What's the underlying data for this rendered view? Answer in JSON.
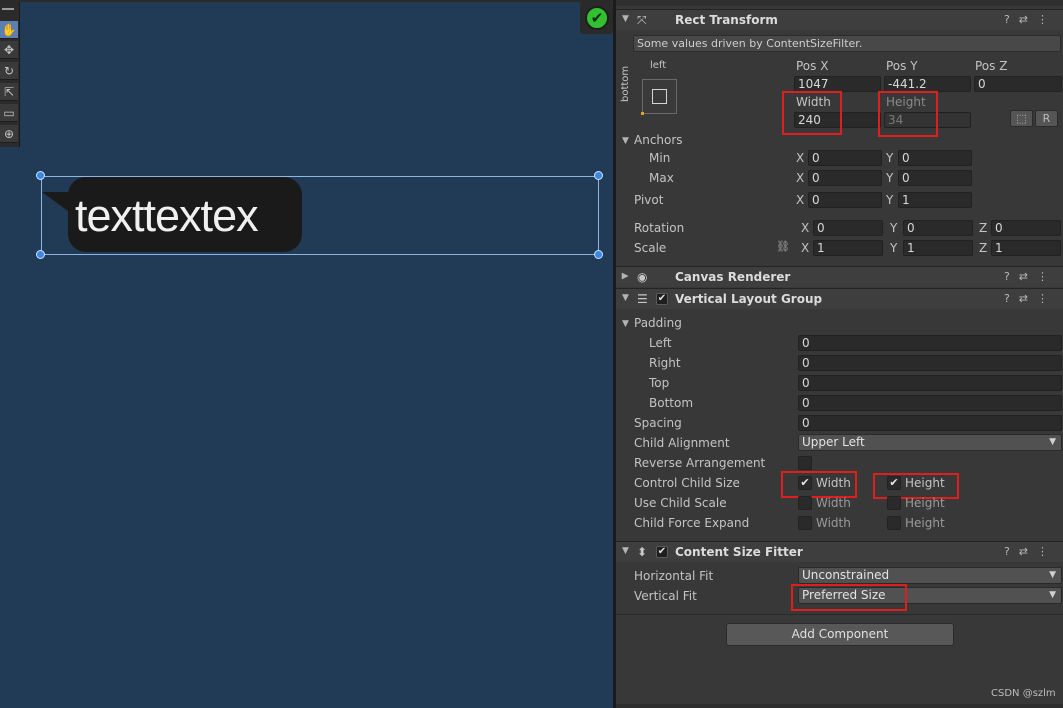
{
  "scene": {
    "bubble_text": "texttextex"
  },
  "watermark": "CSDN @szlm",
  "rect_transform": {
    "title": "Rect Transform",
    "note": "Some values driven by ContentSizeFilter.",
    "anchor_preset_h": "left",
    "anchor_preset_v": "bottom",
    "pos_x_label": "Pos X",
    "pos_y_label": "Pos Y",
    "pos_z_label": "Pos Z",
    "pos_x": "1047",
    "pos_y": "-441.2",
    "pos_z": "0",
    "width_label": "Width",
    "height_label": "Height",
    "width": "240",
    "height": "34",
    "r_button": "R",
    "anchors_label": "Anchors",
    "min_label": "Min",
    "max_label": "Max",
    "pivot_label": "Pivot",
    "rotation_label": "Rotation",
    "scale_label": "Scale",
    "x": "X",
    "y": "Y",
    "z": "Z",
    "anchor_min_x": "0",
    "anchor_min_y": "0",
    "anchor_max_x": "0",
    "anchor_max_y": "0",
    "pivot_x": "0",
    "pivot_y": "1",
    "rotation_x": "0",
    "rotation_y": "0",
    "rotation_z": "0",
    "scale_x": "1",
    "scale_y": "1",
    "scale_z": "1"
  },
  "canvas_renderer": {
    "title": "Canvas Renderer"
  },
  "vertical_layout_group": {
    "title": "Vertical Layout Group",
    "padding_label": "Padding",
    "left_label": "Left",
    "right_label": "Right",
    "top_label": "Top",
    "bottom_label": "Bottom",
    "padding_left": "0",
    "padding_right": "0",
    "padding_top": "0",
    "padding_bottom": "0",
    "spacing_label": "Spacing",
    "spacing": "0",
    "child_alignment_label": "Child Alignment",
    "child_alignment": "Upper Left",
    "reverse_label": "Reverse Arrangement",
    "control_child_size_label": "Control Child Size",
    "use_child_scale_label": "Use Child Scale",
    "child_force_expand_label": "Child Force Expand",
    "width_label": "Width",
    "height_label": "Height"
  },
  "content_size_fitter": {
    "title": "Content Size Fitter",
    "horizontal_fit_label": "Horizontal Fit",
    "horizontal_fit": "Unconstrained",
    "vertical_fit_label": "Vertical Fit",
    "vertical_fit": "Preferred Size"
  },
  "add_component": "Add Component",
  "icons": {
    "check": "✔",
    "dropdown_caret": "▼",
    "help": "?",
    "presets": "⇄",
    "menu": "⋮"
  },
  "colors": {
    "scene_bg": "#213a55",
    "inspector_bg": "#383838",
    "highlight_red": "#e01e1e",
    "selection_blue": "#3e86e6"
  }
}
